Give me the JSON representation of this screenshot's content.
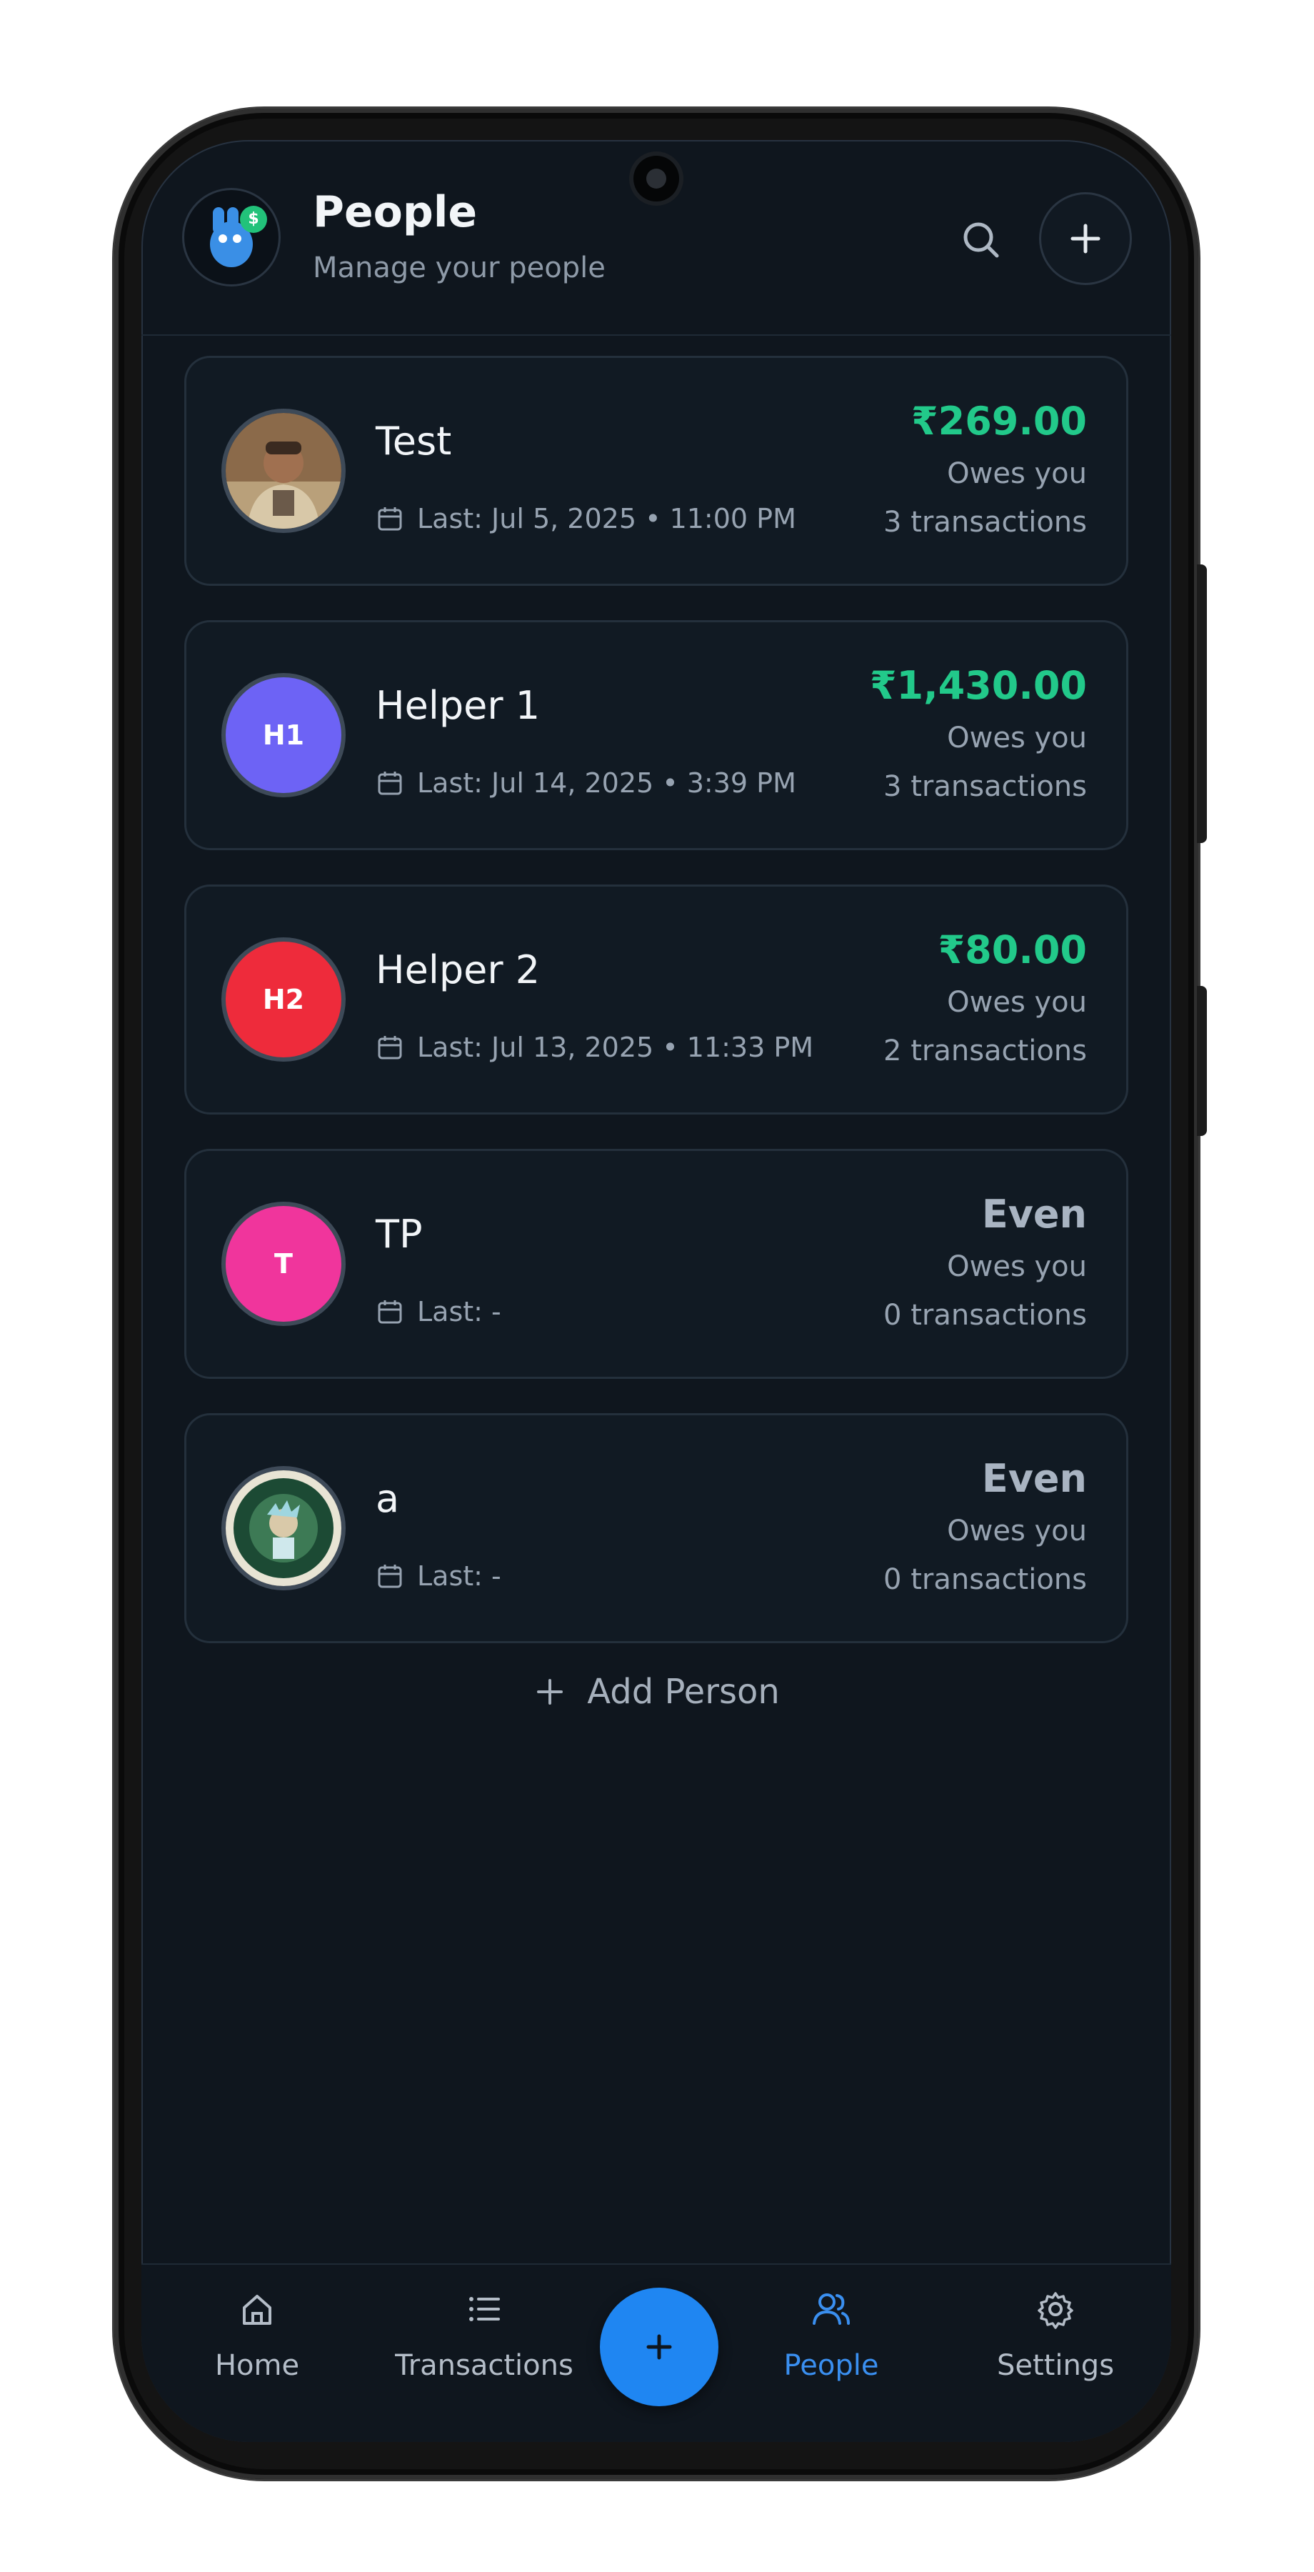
{
  "header": {
    "title": "People",
    "subtitle": "Manage your people",
    "logo_coin": "$"
  },
  "people": [
    {
      "name": "Test",
      "last": "Last: Jul 5, 2025 • 11:00 PM",
      "amount": "₹269.00",
      "status": "Owes you",
      "transactions": "3 transactions"
    },
    {
      "name": "Helper 1",
      "initials": "H1",
      "last": "Last: Jul 14, 2025 • 3:39 PM",
      "amount": "₹1,430.00",
      "status": "Owes you",
      "transactions": "3 transactions"
    },
    {
      "name": "Helper 2",
      "initials": "H2",
      "last": "Last: Jul 13, 2025 • 11:33 PM",
      "amount": "₹80.00",
      "status": "Owes you",
      "transactions": "2 transactions"
    },
    {
      "name": "TP",
      "initials": "T",
      "last": "Last: -",
      "amount": "Even",
      "status": "Owes you",
      "transactions": "0 transactions"
    },
    {
      "name": "a",
      "last": "Last: -",
      "amount": "Even",
      "status": "Owes you",
      "transactions": "0 transactions"
    }
  ],
  "add_person_label": "Add Person",
  "nav": {
    "home": "Home",
    "transactions": "Transactions",
    "people": "People",
    "settings": "Settings"
  },
  "colors": {
    "positive": "#22c98a",
    "even": "#a9b4c2",
    "accent": "#1f86f2",
    "avatar_h1": "#6d63f5",
    "avatar_h2": "#ee2b3b",
    "avatar_t": "#f0359c"
  }
}
